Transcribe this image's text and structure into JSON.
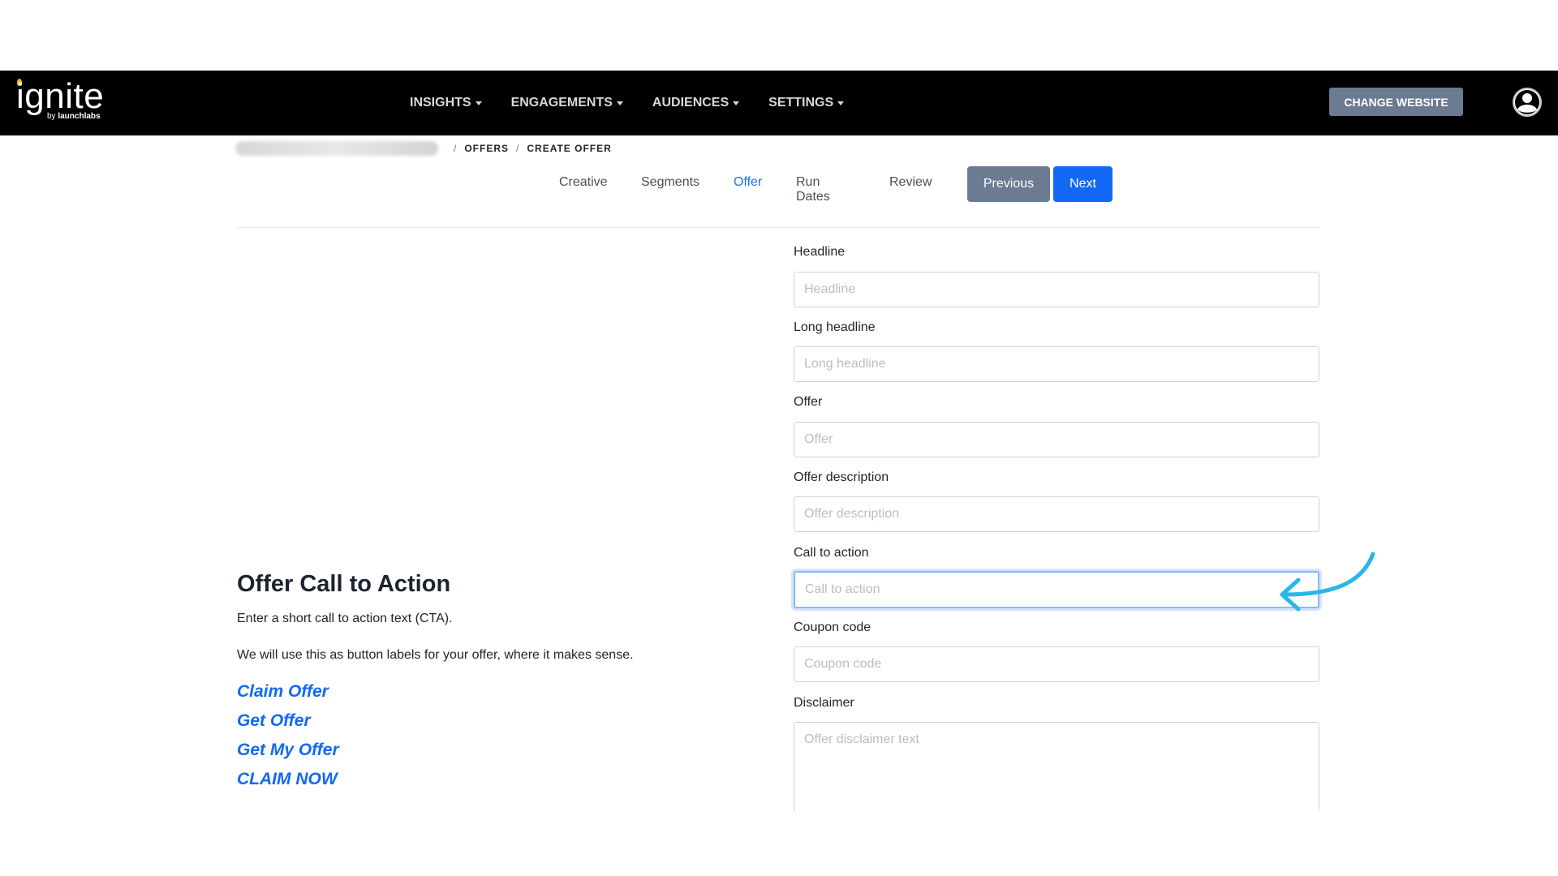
{
  "app": {
    "logo_main": "ignite",
    "logo_sub_prefix": "by ",
    "logo_sub_brand": "launchlabs"
  },
  "nav": {
    "items": [
      {
        "label": "INSIGHTS"
      },
      {
        "label": "ENGAGEMENTS"
      },
      {
        "label": "AUDIENCES"
      },
      {
        "label": "SETTINGS"
      }
    ],
    "change_website": "CHANGE WEBSITE"
  },
  "breadcrumb": {
    "sep": "/",
    "items": [
      "OFFERS",
      "CREATE OFFER"
    ]
  },
  "wizard": {
    "tabs": [
      "Creative",
      "Segments",
      "Offer",
      "Run Dates",
      "Review"
    ],
    "active_tab": "Offer",
    "previous": "Previous",
    "next": "Next"
  },
  "form": {
    "headline": {
      "label": "Headline",
      "placeholder": "Headline"
    },
    "long_headline": {
      "label": "Long headline",
      "placeholder": "Long headline"
    },
    "offer": {
      "label": "Offer",
      "placeholder": "Offer"
    },
    "offer_description": {
      "label": "Offer description",
      "placeholder": "Offer description"
    },
    "call_to_action": {
      "label": "Call to action",
      "placeholder": "Call to action"
    },
    "coupon_code": {
      "label": "Coupon code",
      "placeholder": "Coupon code"
    },
    "disclaimer": {
      "label": "Disclaimer",
      "placeholder": "Offer disclaimer text"
    }
  },
  "help": {
    "title": "Offer Call to Action",
    "line1": "Enter a short call to action text (CTA).",
    "line2": "We will use this as button labels for your offer, where it makes sense.",
    "examples": [
      "Claim Offer",
      "Get Offer",
      "Get My Offer",
      "CLAIM NOW"
    ]
  },
  "colors": {
    "accent": "#1269f5",
    "secondary_button": "#6c7a92",
    "annotation_arrow": "#29b6e8"
  }
}
